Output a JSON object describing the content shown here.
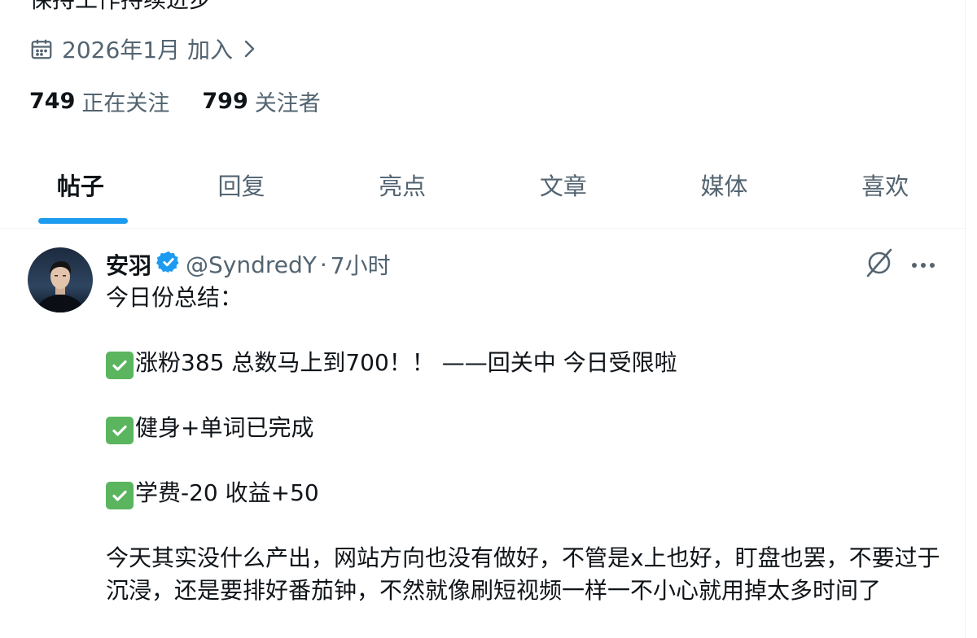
{
  "profile": {
    "bio_partial": "保持工作持续进步",
    "joined_text": "2026年1月 加入",
    "following_count": "749",
    "following_label": "正在关注",
    "followers_count": "799",
    "followers_label": "关注者"
  },
  "tabs": [
    {
      "label": "帖子",
      "active": true
    },
    {
      "label": "回复",
      "active": false
    },
    {
      "label": "亮点",
      "active": false
    },
    {
      "label": "文章",
      "active": false
    },
    {
      "label": "媒体",
      "active": false
    },
    {
      "label": "喜欢",
      "active": false
    }
  ],
  "post": {
    "author_name": "安羽",
    "handle": "@SyndredY",
    "separator": "·",
    "time": "7小时",
    "lines": {
      "intro": "今日份总结：",
      "item1": "涨粉385 总数马上到700！！ ——回关中 今日受限啦",
      "item2": "健身+单词已完成",
      "item3": "学费-20 收益+50",
      "paragraph": "今天其实没什么产出，网站方向也没有做好，不管是x上也好，盯盘也罢，不要过于沉浸，还是要排好番茄钟，不然就像刷短视频一样一不小心就用掉太多时间了"
    }
  },
  "icons": {
    "calendar": "calendar-icon",
    "chevron": "chevron-right-icon",
    "verified": "verified-badge-icon",
    "grok": "grok-icon",
    "more": "more-horizontal-icon",
    "check": "check-mark-icon"
  },
  "colors": {
    "accent": "#1d9bf0",
    "secondary_text": "#536471",
    "check_green": "#5ab55e"
  }
}
